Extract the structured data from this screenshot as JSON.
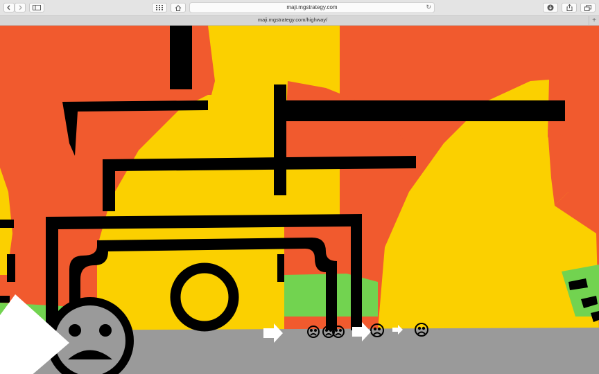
{
  "browser": {
    "address": "maji.mgstrategy.com",
    "tab_title": "maji.mgstrategy.com/highway/",
    "reload_glyph": "↻",
    "new_tab_glyph": "+",
    "icons": [
      "back-icon",
      "forward-icon",
      "sidebar-icon",
      "grid-icon",
      "home-icon",
      "download-icon",
      "share-icon",
      "tabs-icon"
    ]
  },
  "scene": {
    "colors": {
      "orange": "#F15A2E",
      "yellow": "#FBD000",
      "green": "#72D350",
      "road": "#9A9A9A",
      "ink": "#000000",
      "white": "#FFFFFF"
    }
  }
}
